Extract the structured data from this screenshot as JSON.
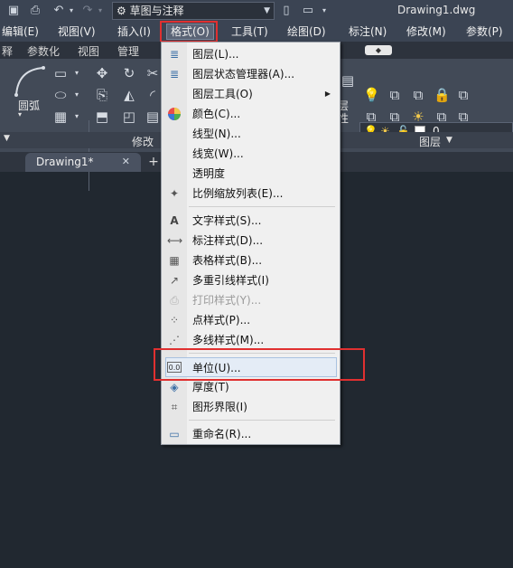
{
  "window": {
    "title": "Drawing1.dwg",
    "workspace": "草图与注释"
  },
  "quick_access": [
    "save-icon",
    "print-icon",
    "undo-icon",
    "redo-icon"
  ],
  "menubar": {
    "items": [
      "编辑(E)",
      "视图(V)",
      "插入(I)",
      "格式(O)",
      "工具(T)",
      "绘图(D)",
      "标注(N)",
      "修改(M)",
      "参数(P)"
    ],
    "active": "格式(O)"
  },
  "ribbon_tabs": [
    "释",
    "参数化",
    "视图",
    "管理"
  ],
  "ribbon": {
    "arc_label": "圆弧",
    "modify_label": "修改",
    "layers_label": "图层",
    "layer_value": "0",
    "layer_side": [
      "层",
      "性"
    ]
  },
  "doc_tab": {
    "label": "Drawing1*",
    "close": "✕",
    "new": "+"
  },
  "format_menu": {
    "items": [
      {
        "label": "图层(L)...",
        "icon": "layers-icon",
        "enabled": true
      },
      {
        "label": "图层状态管理器(A)...",
        "icon": "layer-state-icon",
        "enabled": true
      },
      {
        "label": "图层工具(O)",
        "icon": "",
        "enabled": true,
        "submenu": true
      },
      {
        "label": "颜色(C)...",
        "icon": "color-wheel-icon",
        "enabled": true
      },
      {
        "label": "线型(N)...",
        "icon": "",
        "enabled": true
      },
      {
        "label": "线宽(W)...",
        "icon": "",
        "enabled": true
      },
      {
        "label": "透明度",
        "icon": "",
        "enabled": true
      },
      {
        "label": "比例缩放列表(E)...",
        "icon": "scale-list-icon",
        "enabled": true
      },
      {
        "label": "文字样式(S)...",
        "icon": "text-style-icon",
        "enabled": true
      },
      {
        "label": "标注样式(D)...",
        "icon": "dim-style-icon",
        "enabled": true
      },
      {
        "label": "表格样式(B)...",
        "icon": "table-style-icon",
        "enabled": true
      },
      {
        "label": "多重引线样式(I)",
        "icon": "mleader-style-icon",
        "enabled": true
      },
      {
        "label": "打印样式(Y)...",
        "icon": "plot-style-icon",
        "enabled": false
      },
      {
        "label": "点样式(P)...",
        "icon": "point-style-icon",
        "enabled": true
      },
      {
        "label": "多线样式(M)...",
        "icon": "mline-style-icon",
        "enabled": true
      },
      {
        "label": "单位(U)...",
        "icon": "units-icon",
        "icon_text": "0.0",
        "enabled": true,
        "highlighted": true
      },
      {
        "label": "厚度(T)",
        "icon": "thickness-icon",
        "enabled": true
      },
      {
        "label": "图形界限(I)",
        "icon": "limits-icon",
        "enabled": true
      },
      {
        "label": "重命名(R)...",
        "icon": "rename-icon",
        "enabled": true
      }
    ]
  },
  "colors": {
    "highlight_box": "#e03030",
    "canvas": "#212830",
    "menu_bg": "#f0f0f0"
  }
}
